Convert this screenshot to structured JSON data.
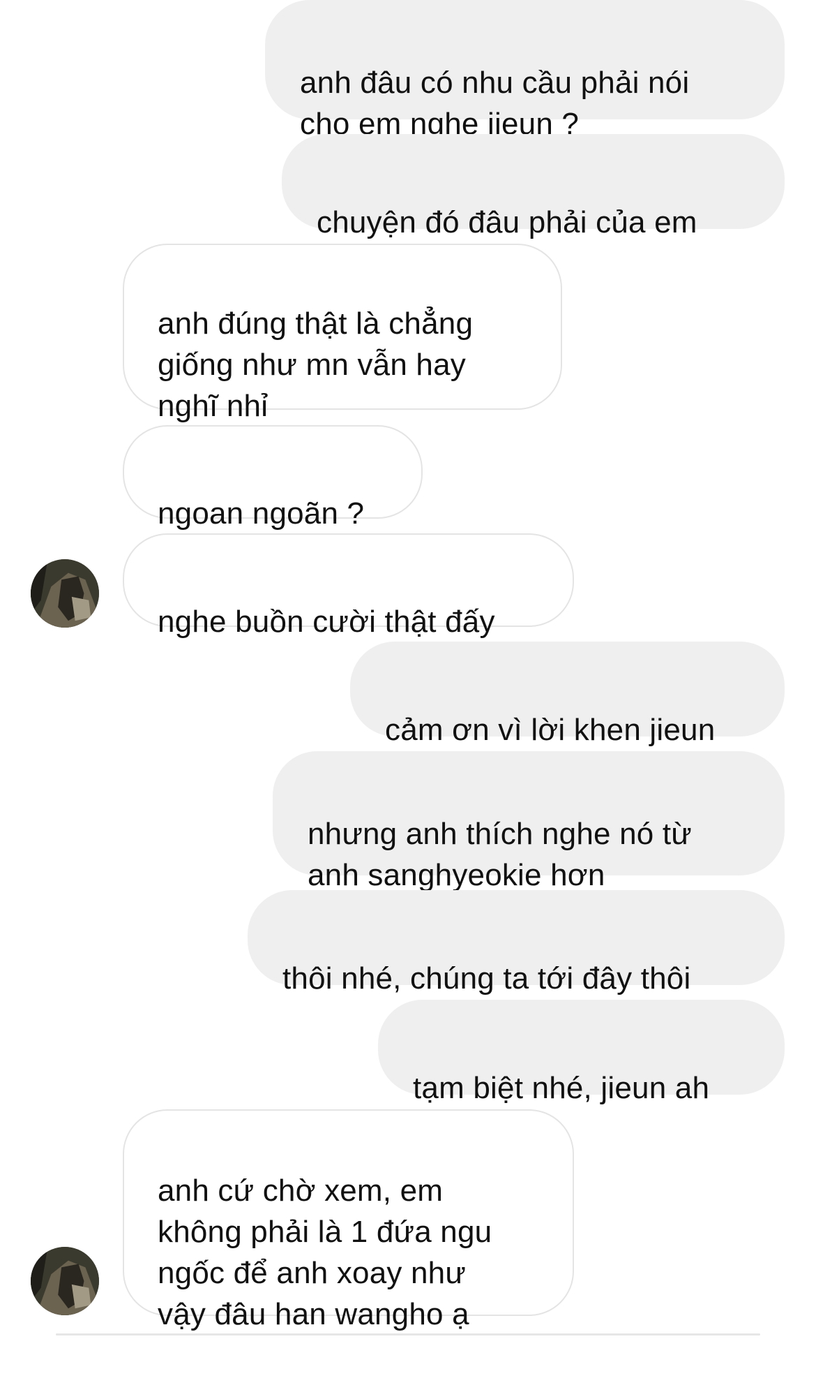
{
  "chat": {
    "messages": [
      {
        "sender": "me",
        "text": "anh đâu có nhu cầu phải nói\ncho em nghe jieun ?"
      },
      {
        "sender": "me",
        "text": "chuyện đó đâu phải của em"
      },
      {
        "sender": "them",
        "text": "anh đúng thật là chẳng\ngiống như mn vẫn hay\nnghĩ nhỉ"
      },
      {
        "sender": "them",
        "text": "ngoan ngoãn ?"
      },
      {
        "sender": "them",
        "text": "nghe buồn cười thật đấy"
      },
      {
        "sender": "me",
        "text": "cảm ơn vì lời khen jieun"
      },
      {
        "sender": "me",
        "text": "nhưng anh thích nghe nó từ\nanh sanghyeokie hơn"
      },
      {
        "sender": "me",
        "text": "thôi nhé, chúng ta tới đây thôi"
      },
      {
        "sender": "me",
        "text": "tạm biệt nhé, jieun ah"
      },
      {
        "sender": "them",
        "text": "anh cứ chờ xem, em\nkhông phải là 1 đứa ngu\nngốc để anh xoay như\nvậy đâu han wangho ạ"
      }
    ],
    "avatar_icon": "profile-photo",
    "colors": {
      "outgoing_bubble": "#efefef",
      "incoming_bubble": "#ffffff",
      "incoming_border": "#e4e4e4",
      "text": "#111111"
    }
  }
}
